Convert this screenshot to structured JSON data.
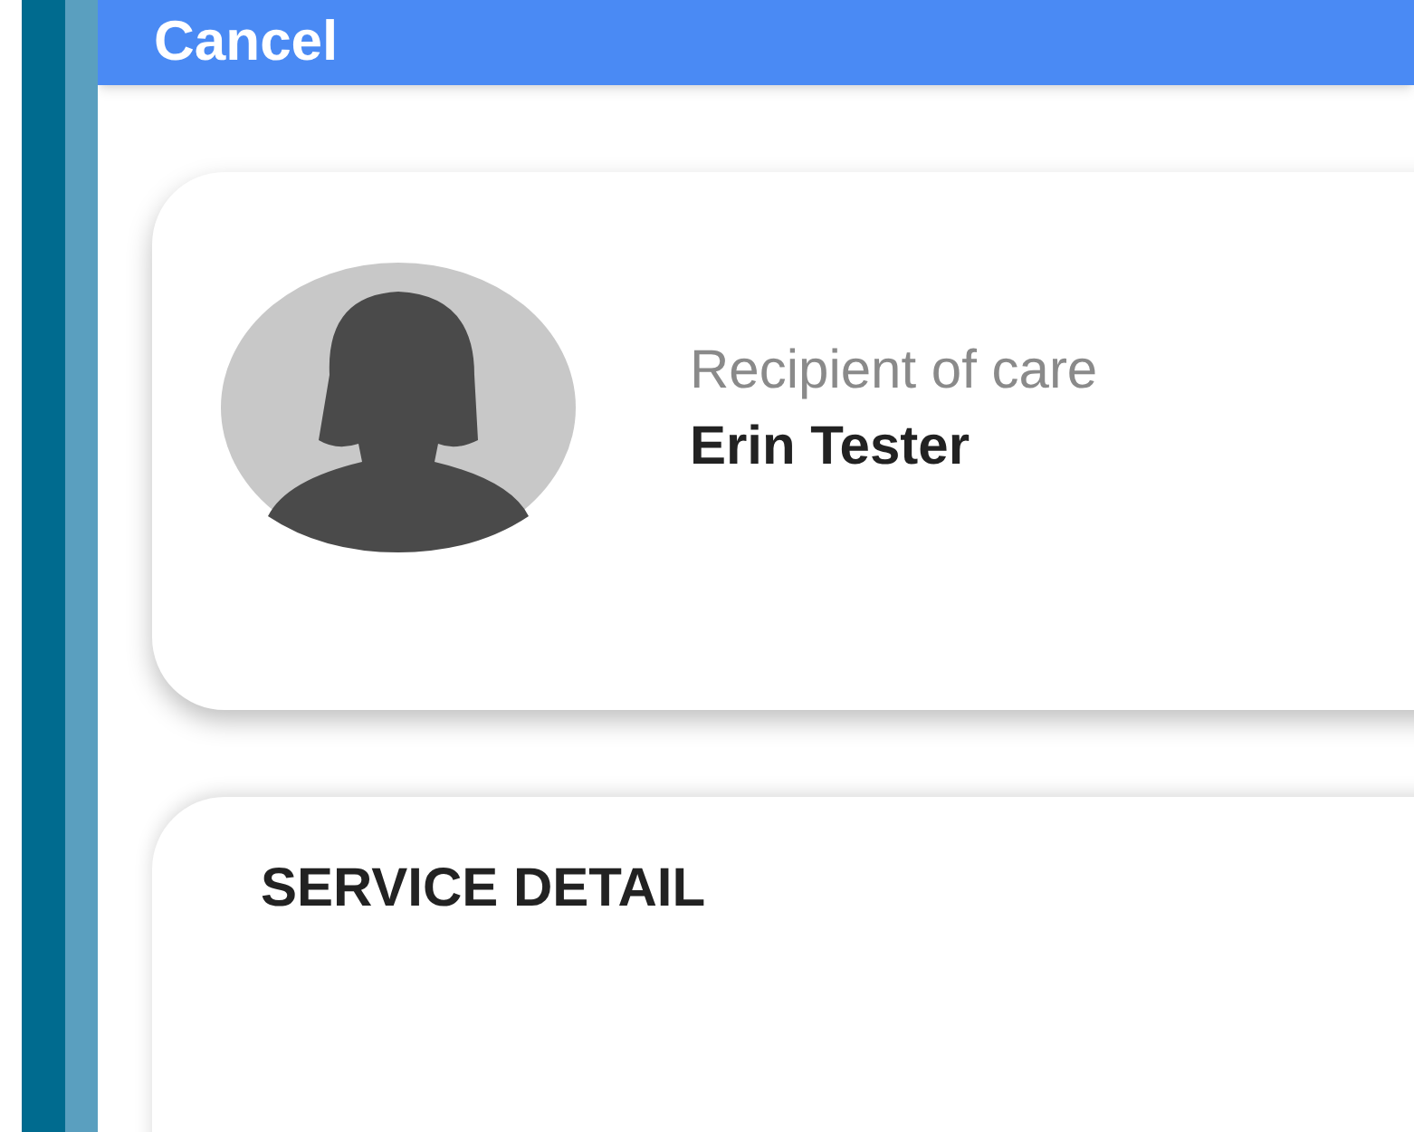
{
  "header": {
    "cancel": "Cancel"
  },
  "recipient": {
    "label": "Recipient of care",
    "name": "Erin Tester"
  },
  "service_detail": {
    "title": "SERVICE DETAIL"
  }
}
